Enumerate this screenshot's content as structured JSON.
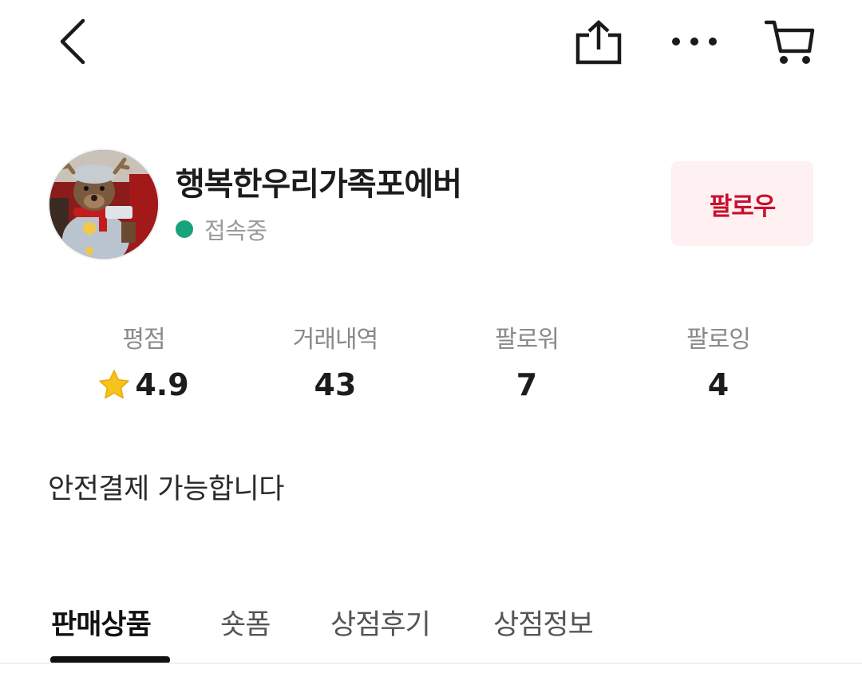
{
  "topbar": {
    "back_icon": "chevron-left-icon",
    "share_icon": "share-icon",
    "more_icon": "more-horizontal-icon",
    "cart_icon": "cart-icon"
  },
  "profile": {
    "store_name": "행복한우리가족포에버",
    "status": "접속중",
    "status_color": "#17a37b",
    "follow_label": "팔로우",
    "follow_color": "#c8102e"
  },
  "stats": [
    {
      "label": "평점",
      "value": "4.9",
      "icon": "star-icon"
    },
    {
      "label": "거래내역",
      "value": "43"
    },
    {
      "label": "팔로워",
      "value": "7"
    },
    {
      "label": "팔로잉",
      "value": "4"
    }
  ],
  "intro": "안전결제 가능합니다",
  "tabs": [
    {
      "label": "판매상품",
      "active": true
    },
    {
      "label": "숏폼",
      "active": false
    },
    {
      "label": "상점후기",
      "active": false
    },
    {
      "label": "상점정보",
      "active": false
    }
  ]
}
